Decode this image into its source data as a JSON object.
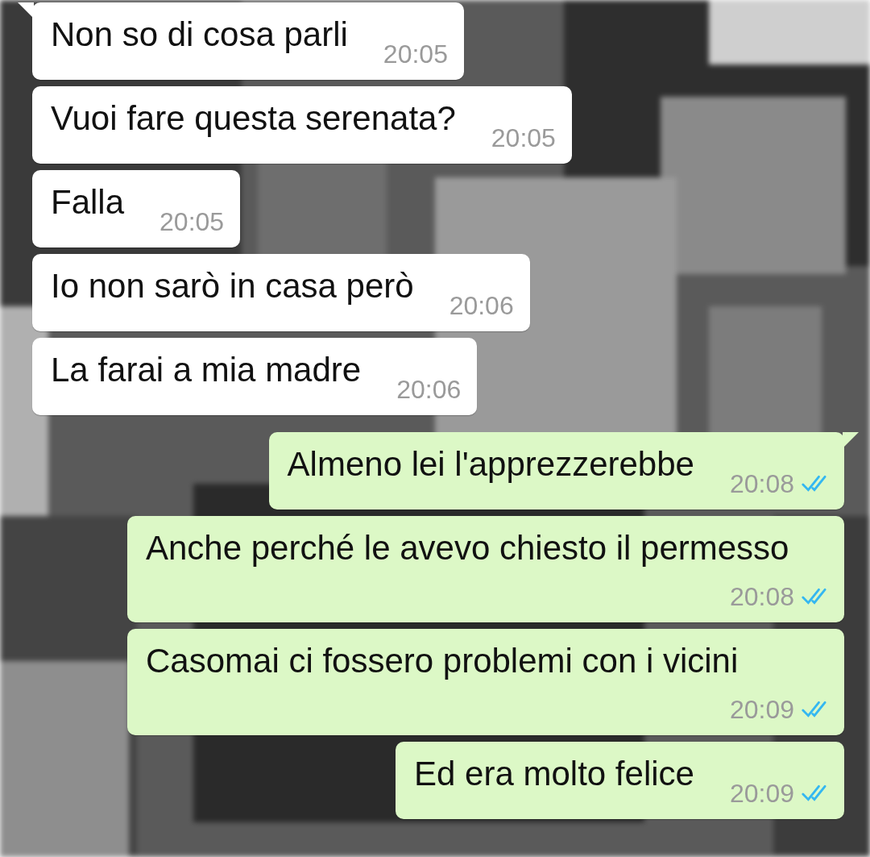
{
  "messages": [
    {
      "outgoing": false,
      "tail": true,
      "text": "Non so di cosa parli",
      "time": "20:05"
    },
    {
      "outgoing": false,
      "tail": false,
      "text": "Vuoi fare questa serenata?",
      "time": "20:05"
    },
    {
      "outgoing": false,
      "tail": false,
      "text": "Falla",
      "time": "20:05"
    },
    {
      "outgoing": false,
      "tail": false,
      "text": "Io non sarò in casa però",
      "time": "20:06"
    },
    {
      "outgoing": false,
      "tail": false,
      "text": "La farai a mia madre",
      "time": "20:06"
    },
    {
      "outgoing": true,
      "tail": true,
      "text": "Almeno lei l'apprezzerebbe",
      "time": "20:08",
      "read": true
    },
    {
      "outgoing": true,
      "tail": false,
      "text": "Anche perché le avevo chiesto il permesso",
      "time": "20:08",
      "read": true
    },
    {
      "outgoing": true,
      "tail": false,
      "text": "Casomai ci fossero problemi con i vicini",
      "time": "20:09",
      "read": true
    },
    {
      "outgoing": true,
      "tail": false,
      "text": "Ed era molto felice",
      "time": "20:09",
      "read": true
    }
  ]
}
